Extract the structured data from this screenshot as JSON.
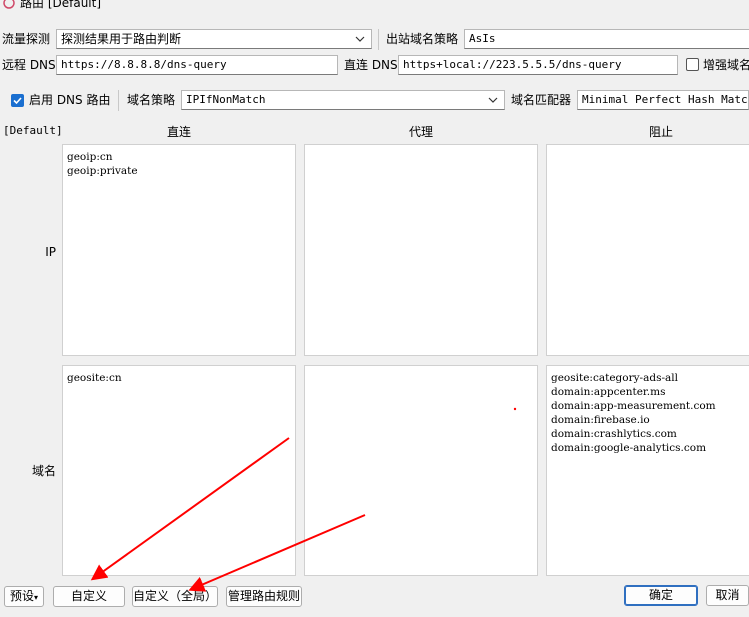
{
  "window": {
    "title": "路由 [Default]"
  },
  "toolbar": {
    "traffic_sniffing_label": "流量探测",
    "traffic_sniffing_value": "探测结果用于路由判断",
    "outbound_domain_strategy_label": "出站域名策略",
    "outbound_domain_strategy_value": "AsIs",
    "remote_dns_label": "远程 DNS",
    "remote_dns_value": "https://8.8.8.8/dns-query",
    "direct_dns_label": "直连 DNS",
    "direct_dns_value": "https+local://223.5.5.5/dns-query",
    "enhanced_domain_label": "增强域名",
    "enable_dns_routing_label": "启用 DNS 路由",
    "domain_strategy_label": "域名策略",
    "domain_strategy_value": "IPIfNonMatch",
    "domain_matcher_label": "域名匹配器",
    "domain_matcher_value": "Minimal Perfect Hash Matcher"
  },
  "grid": {
    "profile_label": "[Default]",
    "columns": [
      "直连",
      "代理",
      "阻止"
    ],
    "rows": [
      "IP",
      "域名"
    ],
    "ip": {
      "direct": "geoip:cn\ngeoip:private",
      "proxy": "",
      "block": ""
    },
    "domain": {
      "direct": "geosite:cn",
      "proxy": "",
      "block": "geosite:category-ads-all\ndomain:appcenter.ms\ndomain:app-measurement.com\ndomain:firebase.io\ndomain:crashlytics.com\ndomain:google-analytics.com"
    }
  },
  "footer": {
    "preset_label": "预设",
    "custom_label": "自定义",
    "custom_global_label": "自定义（全局）",
    "manage_rules_label": "管理路由规则",
    "ok_label": "确定",
    "cancel_label": "取消"
  },
  "colors": {
    "accent": "#1a6fd0",
    "annotation": "#ff0000"
  },
  "state": {
    "enable_dns_routing": true,
    "enhanced_domain": false
  }
}
